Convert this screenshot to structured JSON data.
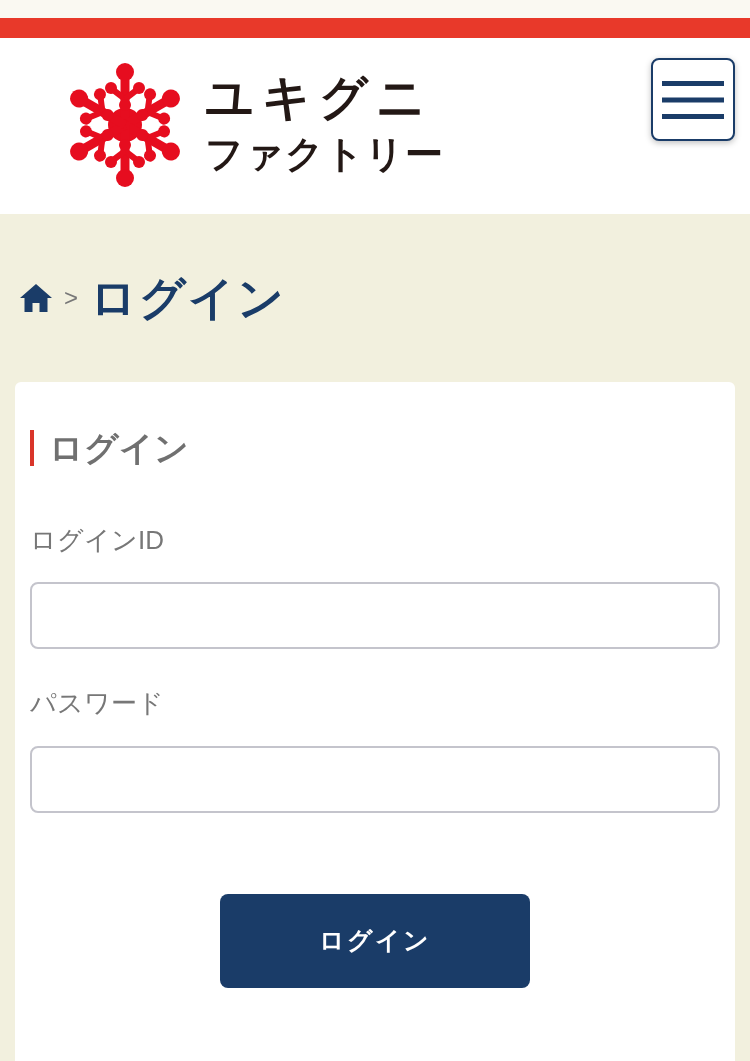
{
  "header": {
    "logo": {
      "name": "ユキグニ",
      "subtitle": "ファクトリー"
    }
  },
  "breadcrumb": {
    "separator": ">",
    "current": "ログイン"
  },
  "login_card": {
    "title": "ログイン",
    "fields": [
      {
        "label": "ログインID"
      },
      {
        "label": "パスワード"
      }
    ],
    "submit_button": "ログイン"
  }
}
